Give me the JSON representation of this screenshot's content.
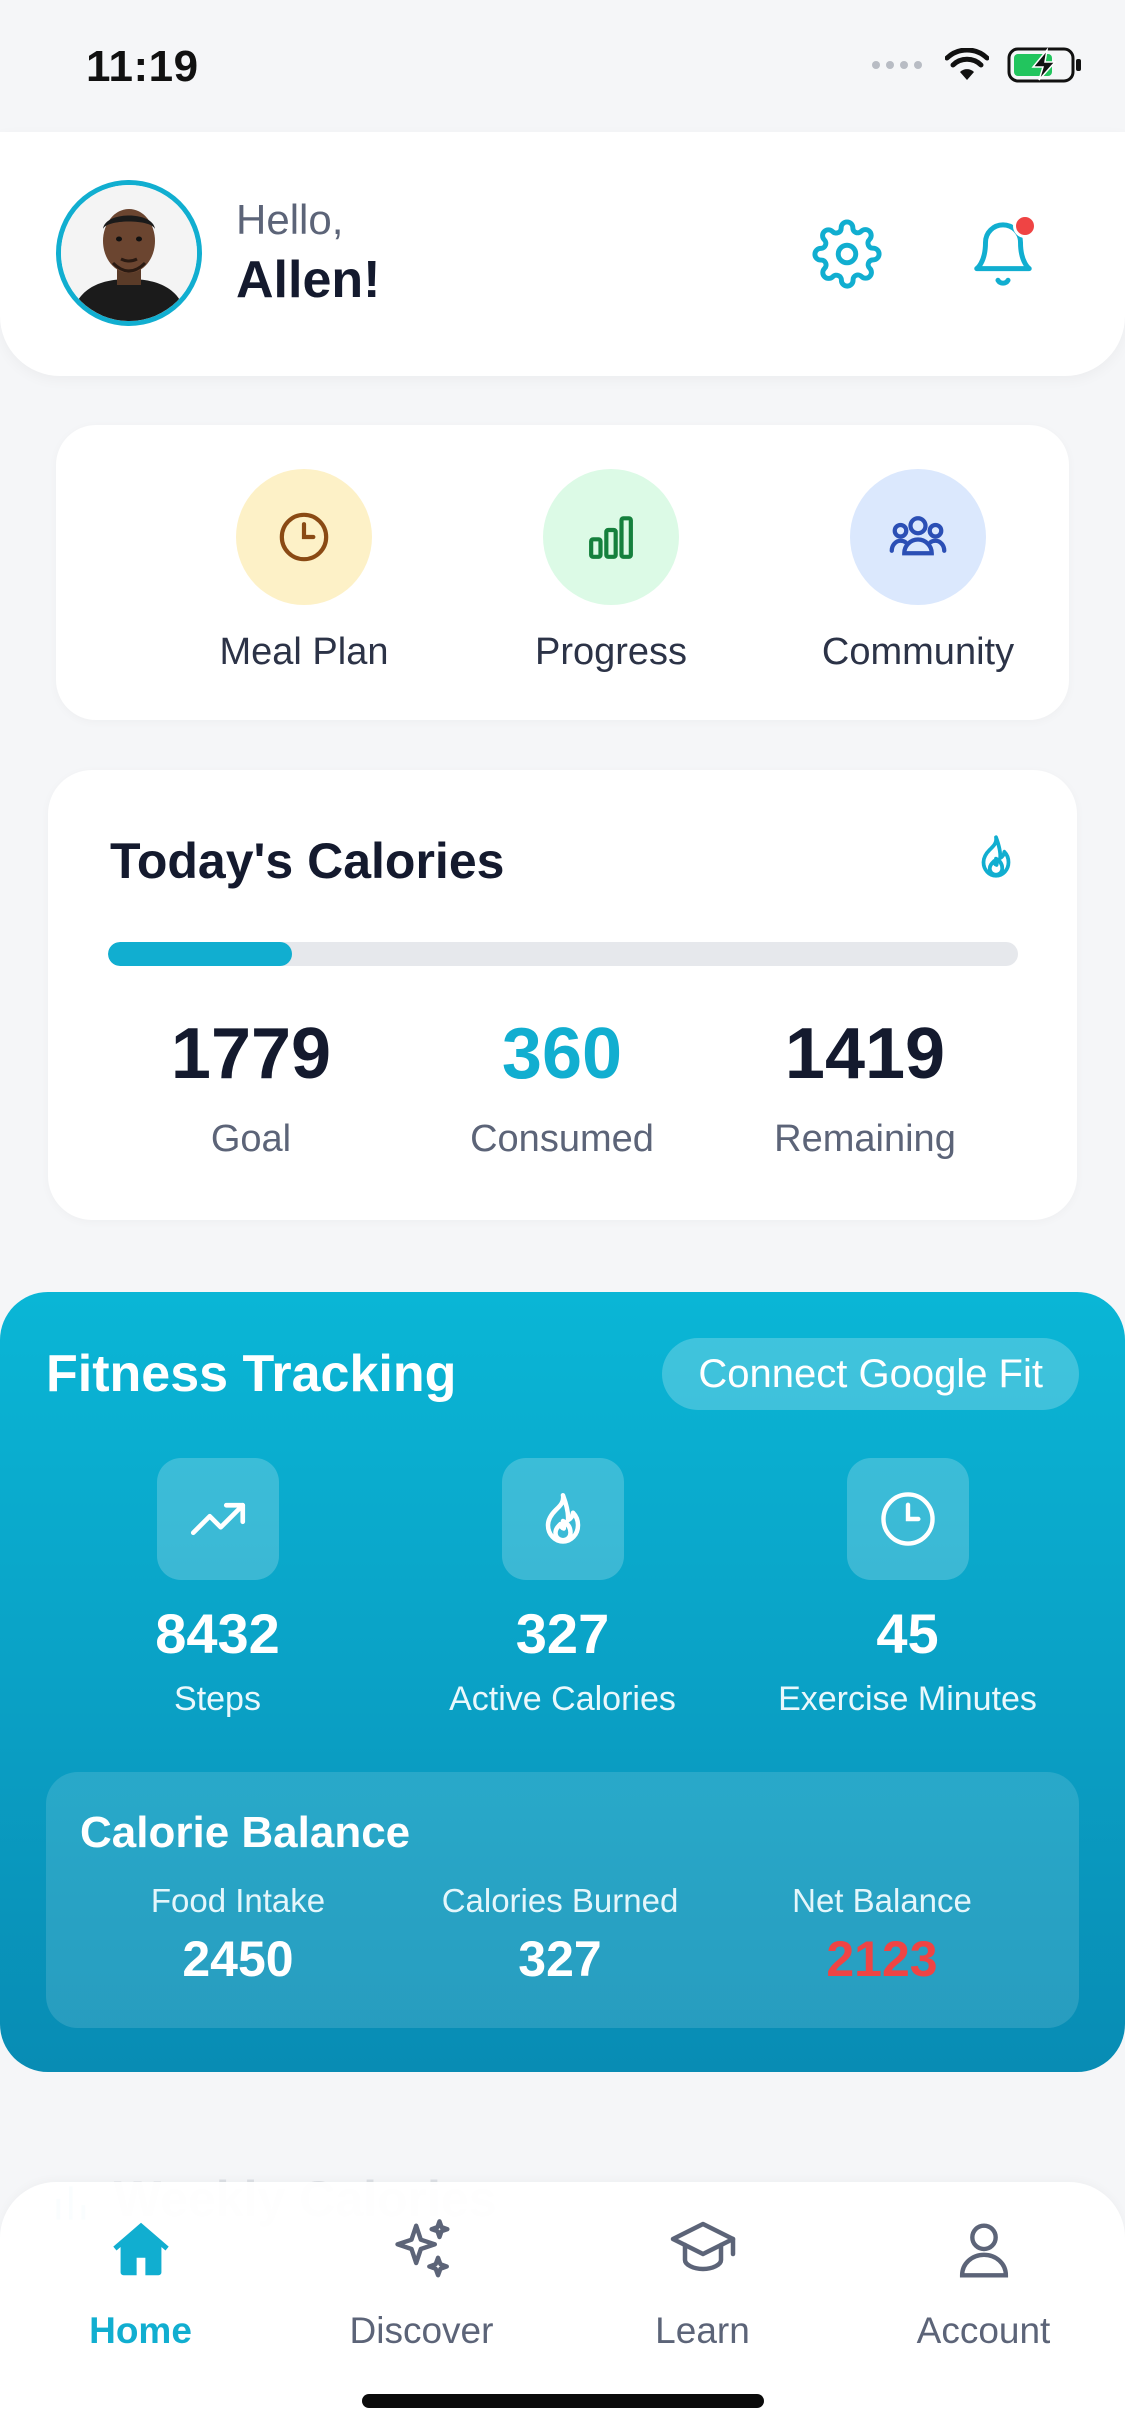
{
  "status_bar": {
    "time": "11:19",
    "icons": [
      "signal-dots-icon",
      "wifi-icon",
      "battery-charging-icon"
    ],
    "battery_color": "#22c55e"
  },
  "header": {
    "greeting": "Hello,",
    "name": "Allen!",
    "accent_color": "#11aed0",
    "notification_dot_color": "#ef4444"
  },
  "quick_actions": [
    {
      "label": "Meal Plan",
      "icon": "clock-icon",
      "bg": "#fdf1c7"
    },
    {
      "label": "Progress",
      "icon": "bar-chart-icon",
      "bg": "#dcfae6"
    },
    {
      "label": "Community",
      "icon": "users-icon",
      "bg": "#dbe8fd"
    }
  ],
  "calories": {
    "title": "Today's Calories",
    "progress_fraction": 0.202,
    "goal": {
      "value": "1779",
      "label": "Goal"
    },
    "consumed": {
      "value": "360",
      "label": "Consumed"
    },
    "remaining": {
      "value": "1419",
      "label": "Remaining"
    }
  },
  "fitness": {
    "title": "Fitness Tracking",
    "connect_label": "Connect Google Fit",
    "stats": [
      {
        "value": "8432",
        "label": "Steps",
        "icon": "trending-up-icon"
      },
      {
        "value": "327",
        "label": "Active Calories",
        "icon": "flame-icon"
      },
      {
        "value": "45",
        "label": "Exercise Minutes",
        "icon": "clock-icon"
      }
    ],
    "balance": {
      "title": "Calorie Balance",
      "food_intake": {
        "label": "Food Intake",
        "value": "2450"
      },
      "burned": {
        "label": "Calories Burned",
        "value": "327"
      },
      "net": {
        "label": "Net Balance",
        "value": "2123",
        "color": "#ef4444"
      }
    }
  },
  "next_section_peek": "Weekly Calories",
  "bottom_nav": [
    {
      "label": "Home",
      "icon": "home-icon",
      "active": true
    },
    {
      "label": "Discover",
      "icon": "sparkles-icon",
      "active": false
    },
    {
      "label": "Learn",
      "icon": "graduation-cap-icon",
      "active": false
    },
    {
      "label": "Account",
      "icon": "user-icon",
      "active": false
    }
  ]
}
